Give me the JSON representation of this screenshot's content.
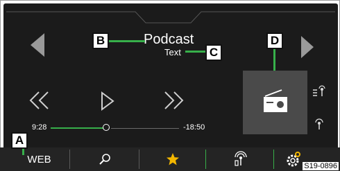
{
  "header": {
    "title": "Podcast",
    "subtitle": "Text"
  },
  "progress": {
    "elapsed": "9:28",
    "remaining": "-18:50",
    "fraction": 0.39
  },
  "bottom_bar": {
    "web_label": "WEB"
  },
  "callouts": {
    "a": "A",
    "b": "B",
    "c": "C",
    "d": "D"
  },
  "figure_code": "S19-0896",
  "colors": {
    "accent": "#37b04a",
    "background": "#1b1b1b",
    "station_tile": "#4a4a4a",
    "favorite": "#f2b600"
  },
  "icons": [
    "prev-arrow-icon",
    "next-arrow-icon",
    "rewind-icon",
    "play-icon",
    "fast-forward-icon",
    "radio-icon",
    "list-icon",
    "antenna-icon",
    "search-icon",
    "star-icon",
    "signal-icon",
    "settings-icon"
  ]
}
